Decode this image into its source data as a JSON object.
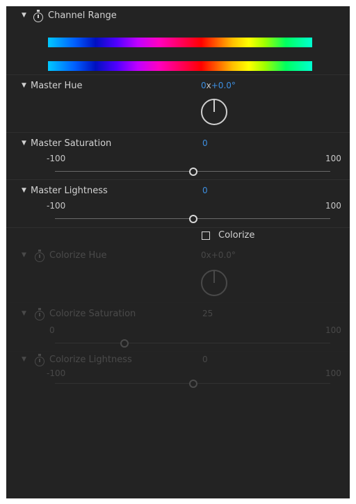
{
  "channel_range": {
    "label": "Channel Range"
  },
  "master_hue": {
    "label": "Master Hue",
    "revolutions": "0",
    "x": "x",
    "degrees": "+0.0°"
  },
  "master_saturation": {
    "label": "Master Saturation",
    "value": "0",
    "min": "-100",
    "max": "100",
    "level": 0
  },
  "master_lightness": {
    "label": "Master Lightness",
    "value": "0",
    "min": "-100",
    "max": "100",
    "level": 0
  },
  "colorize": {
    "label": "Colorize",
    "checked": false
  },
  "colorize_hue": {
    "label": "Colorize Hue",
    "revolutions": "0",
    "x": "x",
    "degrees": "+0.0°"
  },
  "colorize_saturation": {
    "label": "Colorize Saturation",
    "value": "25",
    "min": "0",
    "max": "100",
    "level": 25
  },
  "colorize_lightness": {
    "label": "Colorize Lightness",
    "value": "0",
    "min": "-100",
    "max": "100",
    "level": 0
  },
  "colors": {
    "panel": "#232323",
    "value_blue": "#3d8fe0",
    "text": "#d2d2d2"
  }
}
